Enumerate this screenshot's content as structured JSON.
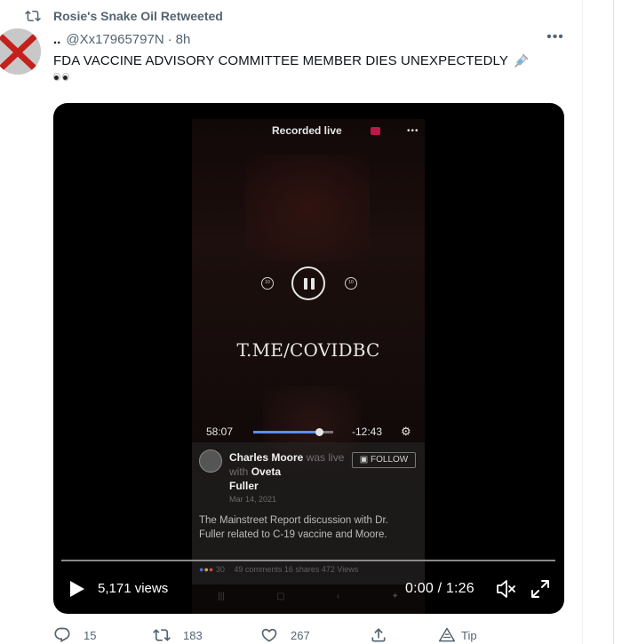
{
  "retweet_banner": {
    "label": "Rosie's Snake Oil Retweeted",
    "icon": "retweet-icon"
  },
  "author": {
    "display_name": "..",
    "handle": "@Xx17965797N",
    "separator": "·",
    "time": "8h"
  },
  "tweet": {
    "text": "FDA VACCINE ADVISORY COMMITTEE MEMBER DIES UNEXPECTEDLY",
    "emoji": [
      "syringe-icon",
      "eyes-icon"
    ]
  },
  "video": {
    "views": "5,171 views",
    "time_display": "0:00 / 1:26",
    "controls": [
      "play-icon",
      "mute-icon",
      "fullscreen-icon"
    ],
    "frame": {
      "header": "Recorded live",
      "watermark": "T.ME/COVIDBC",
      "elapsed": "58:07",
      "remaining": "-12:43",
      "progress": 0.82,
      "poster_name": "Charles Moore",
      "was_live_with": "was live with",
      "guest_first": "Oveta",
      "guest_last": "Fuller",
      "follow_label": "FOLLOW",
      "date": "Mar 14, 2021",
      "description": "The Mainstreet Report discussion with Dr. Fuller related to C-19 vaccine and Moore.",
      "reactions_count": "30",
      "stats": "49 comments 16 shares 472 Views"
    }
  },
  "actions": {
    "reply_count": "15",
    "retweet_count": "183",
    "like_count": "267",
    "tip_label": "Tip"
  },
  "colors": {
    "text": "#0f1419",
    "secondary": "#536471",
    "video_bg": "#000000",
    "accent": "#1d9bf0"
  }
}
